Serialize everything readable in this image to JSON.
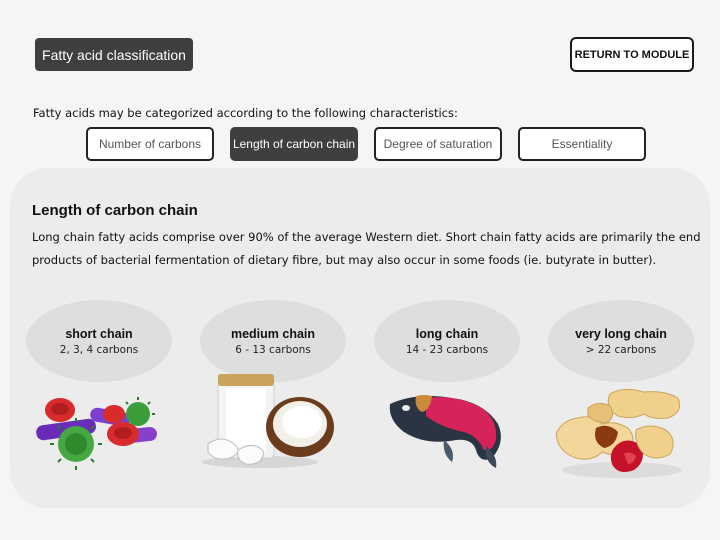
{
  "header": {
    "title": "Fatty acid classification",
    "return_label": "RETURN TO MODULE"
  },
  "intro": "Fatty acids may be categorized according to the following characteristics:",
  "tabs": [
    {
      "label": "Number of carbons",
      "active": false
    },
    {
      "label": "Length of carbon chain",
      "active": true
    },
    {
      "label": "Degree of saturation",
      "active": false
    },
    {
      "label": "Essentiality",
      "active": false
    }
  ],
  "panel": {
    "title": "Length of carbon chain",
    "text": "Long chain fatty acids comprise over 90% of the average Western diet. Short chain fatty acids are primarily the end products of bacterial fermentation of dietary fibre, but may also occur in some foods (ie. butyrate in butter)."
  },
  "categories": [
    {
      "title": "short chain",
      "subtitle": "2, 3, 4 carbons",
      "icon": "bacteria-icon"
    },
    {
      "title": "medium chain",
      "subtitle": "6 - 13 carbons",
      "icon": "coconut-icon"
    },
    {
      "title": "long chain",
      "subtitle": "14 - 23 carbons",
      "icon": "salmon-icon"
    },
    {
      "title": "very long chain",
      "subtitle": "> 22 carbons",
      "icon": "peanuts-icon"
    }
  ]
}
